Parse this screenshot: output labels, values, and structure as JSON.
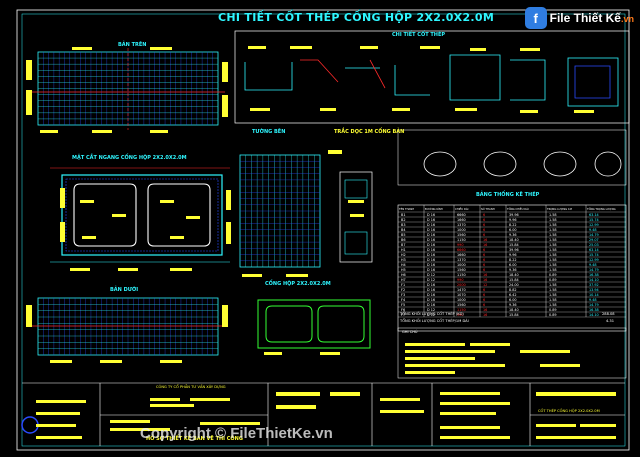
{
  "drawing": {
    "main_title": "CHI TIẾT CỐT THÉP CỐNG HỘP 2X2.0X2.0M",
    "section_labels": {
      "top_slab": "BẢN TRÊN",
      "rebar_detail": "CHI TIẾT CỐT THÉP",
      "wall": "TƯỜNG BÊN",
      "longitudinal": "TRẮC DỌC 1M CỐNG BẢN",
      "cross_section": "MẶT CẮT NGANG CỐNG HỘP 2X2.0X2.0M",
      "bottom_slab": "BẢN DƯỚI",
      "box_culvert": "CỐNG HỘP 2X2.0X2.0M",
      "table_title": "BẢNG THỐNG KÊ THÉP",
      "notes_title": "GHI CHÚ"
    },
    "title_block": {
      "company": "CÔNG TY CỔ PHẦN TƯ VẤN XÂY DỰNG",
      "subtitle": "HỒ SƠ THIẾT KẾ BẢN VẼ THI CÔNG",
      "sheet_title": "CỐT THÉP CỐNG HỘP 2X2.0X2.0M"
    }
  },
  "table": {
    "headers": [
      "TÊN THANH",
      "ĐƯỜNG KÍNH",
      "CHIỀU DÀI",
      "SỐ THANH",
      "TỔNG CHIỀU DÀI",
      "TRỌNG LƯỢNG 1M",
      "TỔNG TRỌNG LƯỢNG"
    ],
    "rows": [
      [
        "B1",
        "D 16",
        "6660",
        "6",
        "39.96",
        "1.58",
        "63.14"
      ],
      [
        "B2",
        "D 16",
        "1660",
        "6",
        "9.96",
        "1.58",
        "15.74"
      ],
      [
        "B3",
        "D 16",
        "1370",
        "6",
        "8.22",
        "1.58",
        "12.99"
      ],
      [
        "B4",
        "D 16",
        "1000",
        "6",
        "6.00",
        "1.58",
        "9.48"
      ],
      [
        "B5",
        "D 16",
        "1560",
        "6",
        "9.36",
        "1.58",
        "14.79"
      ],
      [
        "B6",
        "D 16",
        "1150",
        "16",
        "18.40",
        "1.58",
        "29.07"
      ],
      [
        "B7",
        "D 16",
        "990",
        "16",
        "15.84",
        "1.58",
        "25.03"
      ],
      [
        "H1",
        "D 16",
        "6660",
        "6",
        "39.96",
        "1.58",
        "63.14"
      ],
      [
        "H2",
        "D 16",
        "1660",
        "6",
        "9.96",
        "1.58",
        "15.74"
      ],
      [
        "H3",
        "D 16",
        "1370",
        "6",
        "8.22",
        "1.58",
        "12.99"
      ],
      [
        "H4",
        "D 16",
        "1000",
        "6",
        "6.00",
        "1.58",
        "9.48"
      ],
      [
        "H5",
        "D 16",
        "1560",
        "6",
        "9.36",
        "1.58",
        "14.79"
      ],
      [
        "H6",
        "D 12",
        "1150",
        "16",
        "18.40",
        "0.89",
        "16.38"
      ],
      [
        "H7",
        "D 12",
        "990",
        "16",
        "15.84",
        "0.89",
        "14.10"
      ],
      [
        "F1",
        "D 16",
        "2000",
        "12",
        "24.00",
        "1.58",
        "37.92"
      ],
      [
        "F2",
        "D 16",
        "1470",
        "6",
        "8.82",
        "1.58",
        "13.94"
      ],
      [
        "F3",
        "D 16",
        "1070",
        "6",
        "6.42",
        "1.58",
        "10.14"
      ],
      [
        "F4",
        "D 16",
        "1000",
        "6",
        "6.00",
        "1.58",
        "9.48"
      ],
      [
        "F5",
        "D 16",
        "1560",
        "6",
        "9.36",
        "1.58",
        "14.79"
      ],
      [
        "F6",
        "D 12",
        "1150",
        "16",
        "18.40",
        "0.89",
        "16.38"
      ],
      [
        "F7",
        "D 12",
        "990",
        "16",
        "15.84",
        "0.89",
        "14.10"
      ]
    ],
    "total_label": "TỔNG KHỐI LƯỢNG CỐT THÉP (KG)",
    "total_value": "288.08",
    "per_meter_label": "TỔNG KHỐI LƯỢNG CỐT THÉP/1M DÀI",
    "per_meter_value": "4.31"
  },
  "logo": {
    "initial": "f",
    "name": "File Thiết Kế",
    "tld": ".vn"
  },
  "watermark": "Copyright © FileThietKe.vn",
  "colors": {
    "cyan": "#2ff6ff",
    "yellow": "#ffff33",
    "white": "#ffffff",
    "blue": "#2a4cff",
    "red": "#ff2a2a",
    "green": "#33ff33",
    "magenta": "#ff33ff"
  }
}
